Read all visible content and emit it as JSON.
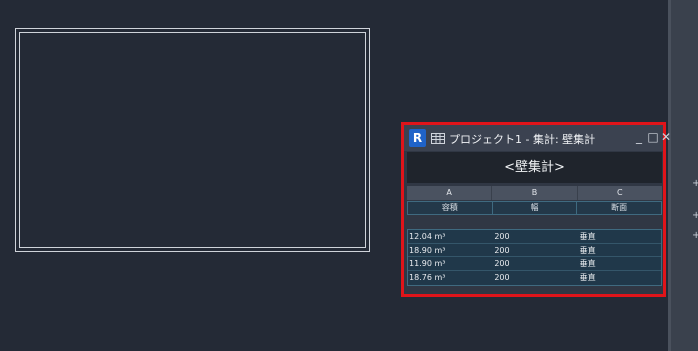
{
  "window": {
    "app_icon": "R",
    "title": "プロジェクト1 - 集計: 壁集計",
    "schedule_title": "<壁集計>",
    "columns": [
      "A",
      "B",
      "C"
    ],
    "headers": [
      "容積",
      "幅",
      "断面"
    ],
    "rows": [
      [
        "12.04 m³",
        "200",
        "垂直"
      ],
      [
        "18.90 m³",
        "200",
        "垂直"
      ],
      [
        "11.90 m³",
        "200",
        "垂直"
      ],
      [
        "18.76 m³",
        "200",
        "垂直"
      ]
    ]
  },
  "colors": {
    "highlight": "#e0141a",
    "background": "#242a36",
    "revit_blue": "#1f63c9"
  }
}
